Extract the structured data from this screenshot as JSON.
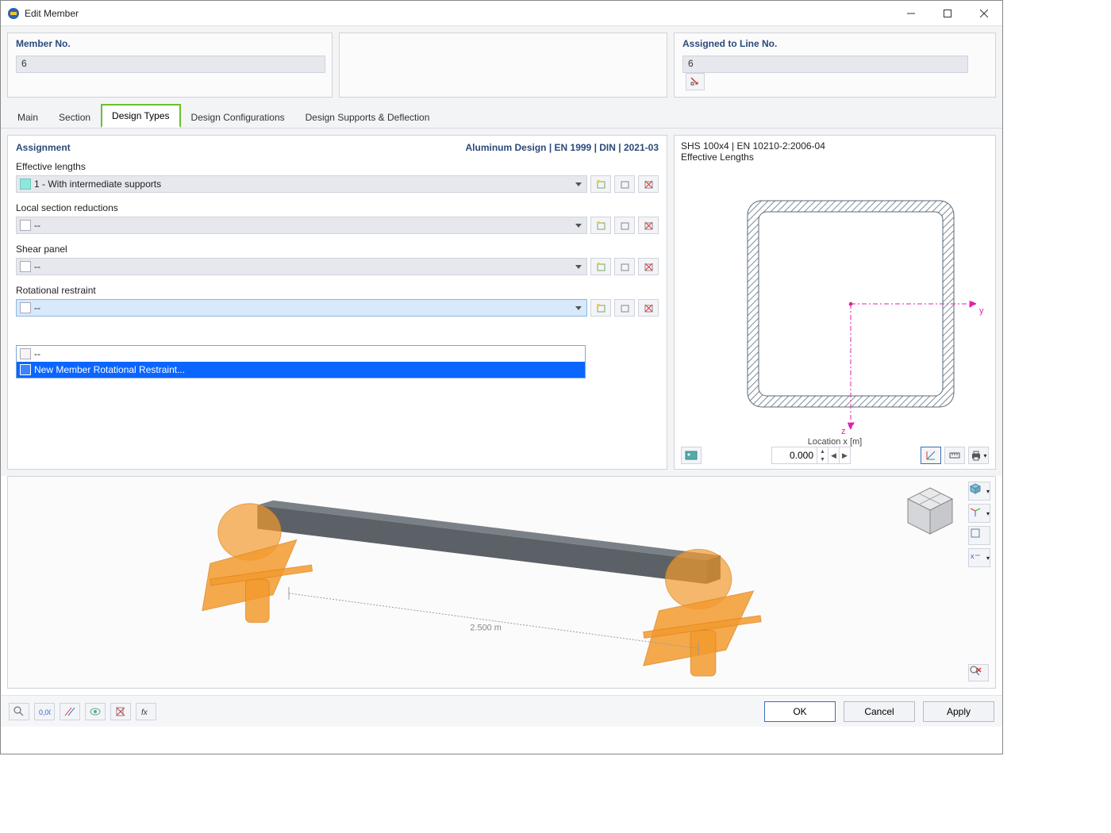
{
  "window": {
    "title": "Edit Member"
  },
  "header": {
    "member_no_label": "Member No.",
    "member_no_value": "6",
    "assigned_label": "Assigned to Line No.",
    "assigned_value": "6"
  },
  "tabs": [
    {
      "label": "Main"
    },
    {
      "label": "Section"
    },
    {
      "label": "Design Types"
    },
    {
      "label": "Design Configurations"
    },
    {
      "label": "Design Supports & Deflection"
    }
  ],
  "assignment": {
    "title": "Assignment",
    "standard": "Aluminum Design | EN 1999 | DIN | 2021-03",
    "fields": {
      "effective_lengths": {
        "label": "Effective lengths",
        "value": "1 - With intermediate supports"
      },
      "local_section_reductions": {
        "label": "Local section reductions",
        "value": "--"
      },
      "shear_panel": {
        "label": "Shear panel",
        "value": "--"
      },
      "rotational_restraint": {
        "label": "Rotational restraint",
        "value": "--",
        "options": [
          {
            "label": "--"
          },
          {
            "label": "New Member Rotational Restraint..."
          }
        ]
      }
    }
  },
  "section_preview": {
    "title": "SHS 100x4 | EN 10210-2:2006-04",
    "subtitle": "Effective Lengths",
    "location_label": "Location x [m]",
    "location_value": "0.000",
    "axis_y": "y",
    "axis_z": "z"
  },
  "viewer3d": {
    "dimension": "2.500 m"
  },
  "footer": {
    "ok": "OK",
    "cancel": "Cancel",
    "apply": "Apply"
  },
  "icons": {
    "new": "new-icon",
    "edit": "edit-icon",
    "delete": "delete-icon",
    "pick": "pick-icon"
  }
}
